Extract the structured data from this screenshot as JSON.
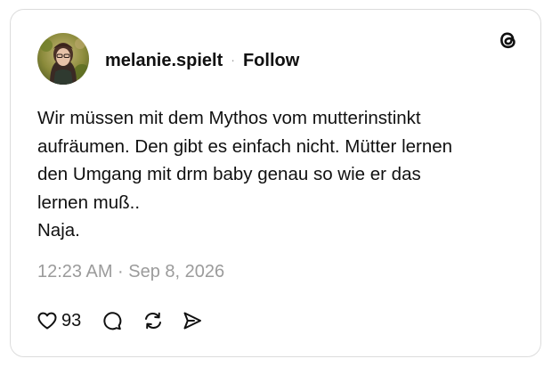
{
  "post": {
    "author": {
      "username": "melanie.spielt",
      "separator": "·",
      "follow_label": "Follow"
    },
    "text_lines": [
      "Wir müssen mit dem Mythos vom mutterinstinkt",
      "aufräumen. Den gibt es einfach nicht. Mütter lernen",
      "den Umgang mit drm baby genau so wie er das",
      "lernen muß..",
      "Naja."
    ],
    "timestamp": "12:23 AM · Sep 8, 2026",
    "stats": {
      "likes": "93"
    },
    "icons": {
      "brand": "threads-logo-icon",
      "like": "heart-icon",
      "reply": "comment-icon",
      "repost": "repost-icon",
      "share": "send-icon"
    }
  },
  "colors": {
    "text": "#101010",
    "muted": "#9b9b9b",
    "border": "#dcdcdc",
    "background": "#ffffff"
  }
}
